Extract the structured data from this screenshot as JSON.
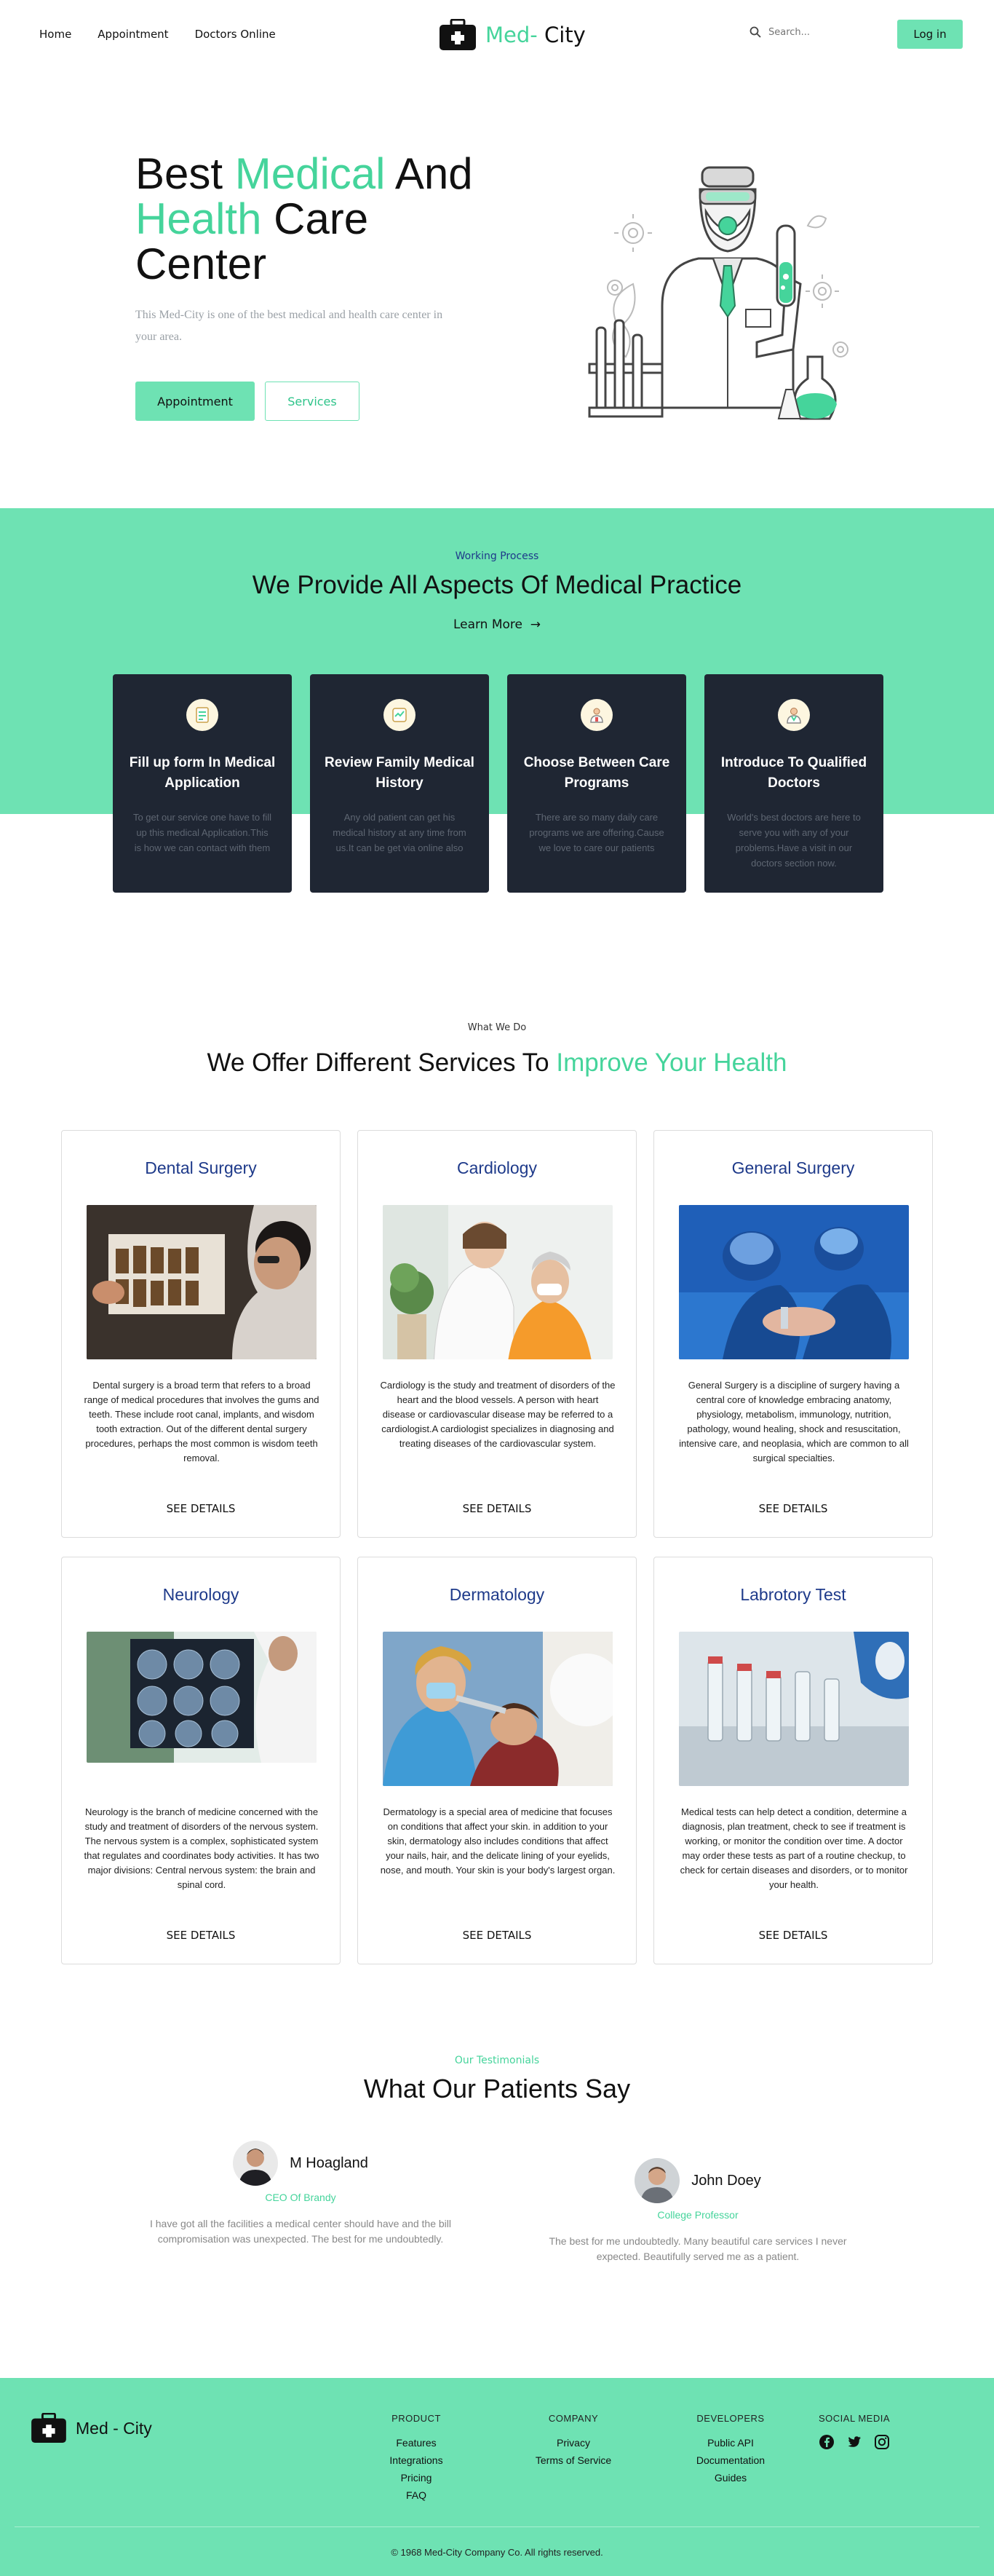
{
  "nav": {
    "links": [
      "Home",
      "Appointment",
      "Doctors Online"
    ],
    "brand_part1": "Med-",
    "brand_part2": " City",
    "search_placeholder": "Search...",
    "login_label": "Log in"
  },
  "hero": {
    "title_w1": "Best ",
    "title_w2": "Medical",
    "title_w3": " And",
    "title_w4": "Health",
    "title_w5": " Care",
    "title_w6": "Center",
    "subtitle": "This Med-City is one of the best medical and health care center in your area.",
    "appointment_label": "Appointment",
    "services_label": "Services"
  },
  "process": {
    "label": "Working Process",
    "title": "We Provide All Aspects Of Medical Practice",
    "learn_more": "Learn More",
    "cards": [
      {
        "title": "Fill up form In Medical Application",
        "text": "To get our service one have to fill up this medical Application.This is how we can contact with them",
        "icon": "form-icon"
      },
      {
        "title": "Review Family Medical History",
        "text": "Any old patient can get his medical history at any time from us.It can be get via online also",
        "icon": "history-icon"
      },
      {
        "title": "Choose Between Care Programs",
        "text": "There are so many daily care programs we are offering.Cause we love to care our patients",
        "icon": "care-icon"
      },
      {
        "title": "Introduce To Qualified Doctors",
        "text": "World's best doctors are here to serve you with any of your problems.Have a visit in our doctors section now.",
        "icon": "doctor-icon"
      }
    ]
  },
  "services": {
    "label": "What We Do",
    "title_part1": "We Offer Different Services To ",
    "title_part2": "Improve Your Health",
    "see_details": "SEE DETAILS",
    "items": [
      {
        "title": "Dental Surgery",
        "text": "Dental surgery is a broad term that refers to a broad range of medical procedures that involves the gums and teeth. These include root canal, implants, and wisdom tooth extraction. Out of the different dental surgery procedures, perhaps the most common is wisdom teeth removal."
      },
      {
        "title": "Cardiology",
        "text": "Cardiology is the study and treatment of disorders of the heart and the blood vessels. A person with heart disease or cardiovascular disease may be referred to a cardiologist.A cardiologist specializes in diagnosing and treating diseases of the cardiovascular system."
      },
      {
        "title": "General Surgery",
        "text": "General Surgery is a discipline of surgery having a central core of knowledge embracing anatomy, physiology, metabolism, immunology, nutrition, pathology, wound healing, shock and resuscitation, intensive care, and neoplasia, which are common to all surgical specialties."
      },
      {
        "title": "Neurology",
        "text": "Neurology is the branch of medicine concerned with the study and treatment of disorders of the nervous system. The nervous system is a complex, sophisticated system that regulates and coordinates body activities. It has two major divisions: Central nervous system: the brain and spinal cord."
      },
      {
        "title": "Dermatology",
        "text": "Dermatology is a special area of medicine that focuses on conditions that affect your skin. in addition to your skin, dermatology also includes conditions that affect your nails, hair, and the delicate lining of your eyelids, nose, and mouth. Your skin is your body's largest organ."
      },
      {
        "title": "Labrotory Test",
        "text": "Medical tests can help detect a condition, determine a diagnosis, plan treatment, check to see if treatment is working, or monitor the condition over time. A doctor may order these tests as part of a routine checkup, to check for certain diseases and disorders, or to monitor your health."
      }
    ]
  },
  "testimonials": {
    "label": "Our Testimonials",
    "title": "What Our Patients Say",
    "items": [
      {
        "name": "M Hoagland",
        "role": "CEO Of Brandy",
        "quote": "I have got all the facilities a medical center should have and the bill compromisation was unexpected. The best for me undoubtedly."
      },
      {
        "name": "John Doey",
        "role": "College Professor",
        "quote": "The best for me undoubtedly. Many beautiful care services I never expected. Beautifully served me as a patient."
      }
    ]
  },
  "footer": {
    "brand": "Med - City",
    "product": {
      "heading": "PRODUCT",
      "items": [
        "Features",
        "Integrations",
        "Pricing",
        "FAQ"
      ]
    },
    "company": {
      "heading": "COMPANY",
      "items": [
        "Privacy",
        "Terms of Service"
      ]
    },
    "developers": {
      "heading": "DEVELOPERS",
      "items": [
        "Public API",
        "Documentation",
        "Guides"
      ]
    },
    "social": {
      "heading": "SOCIAL MEDIA",
      "icons": [
        "facebook-icon",
        "twitter-icon",
        "instagram-icon"
      ]
    },
    "copyright": "© 1968 Med-City Company Co. All rights reserved."
  },
  "colors": {
    "accent": "#6ee2b3",
    "accent_text": "#45d49b",
    "dark_card": "#1f2633",
    "navy": "#1e3a8a"
  }
}
